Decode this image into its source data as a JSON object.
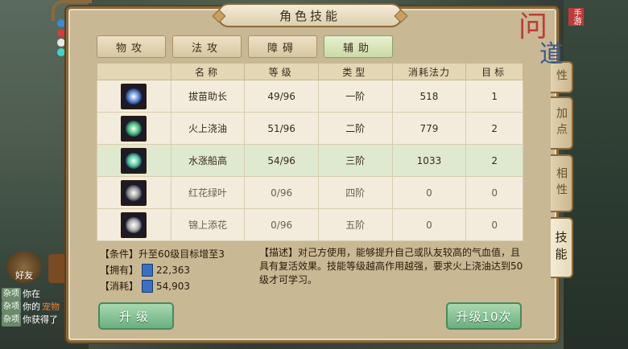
{
  "panel": {
    "title": "角色技能"
  },
  "tabs": [
    {
      "label": "物攻",
      "active": false
    },
    {
      "label": "法攻",
      "active": false
    },
    {
      "label": "障碍",
      "active": false
    },
    {
      "label": "辅助",
      "active": true
    }
  ],
  "table": {
    "headers": [
      "名称",
      "等级",
      "类型",
      "消耗法力",
      "目标"
    ],
    "rows": [
      {
        "name": "拔苗助长",
        "level": "49/96",
        "type": "一阶",
        "cost": "518",
        "target": "1",
        "icon_color": "#5a8ad8",
        "selected": false,
        "locked": false
      },
      {
        "name": "火上浇油",
        "level": "51/96",
        "type": "二阶",
        "cost": "779",
        "target": "2",
        "icon_color": "#4ac080",
        "selected": false,
        "locked": false
      },
      {
        "name": "水涨船高",
        "level": "54/96",
        "type": "三阶",
        "cost": "1033",
        "target": "2",
        "icon_color": "#50c8a0",
        "selected": true,
        "locked": false
      },
      {
        "name": "红花绿叶",
        "level": "0/96",
        "type": "四阶",
        "cost": "0",
        "target": "0",
        "icon_color": "#9a9a9a",
        "selected": false,
        "locked": true
      },
      {
        "name": "锦上添花",
        "level": "0/96",
        "type": "五阶",
        "cost": "0",
        "target": "0",
        "icon_color": "#b0b0b0",
        "selected": false,
        "locked": true
      }
    ]
  },
  "info": {
    "condition": "【条件】升至60级目标增至3",
    "owned_label": "【拥有】",
    "owned_value": "22,363",
    "consume_label": "【消耗】",
    "consume_value": "54,903",
    "description": "【描述】对己方使用，能够提升自己或队友较高的气血值，且具有复活效果。技能等级越高作用越强，要求火上浇油达到50级才可学习。"
  },
  "buttons": {
    "upgrade": "升级",
    "upgrade10": "升级10次"
  },
  "side_tabs": [
    {
      "label": "性",
      "active": false
    },
    {
      "label": "加点",
      "active": false
    },
    {
      "label": "相性",
      "active": false
    },
    {
      "label": "技能",
      "active": true
    }
  ],
  "logo": {
    "main": "问",
    "sub": "道",
    "tag": "手游"
  },
  "chat": [
    {
      "tag": "杂项",
      "text": "你在"
    },
    {
      "tag": "杂项",
      "text": "你的",
      "highlight": "宠物"
    },
    {
      "tag": "杂项",
      "text": "你获得了"
    }
  ],
  "friend_label": "好友"
}
